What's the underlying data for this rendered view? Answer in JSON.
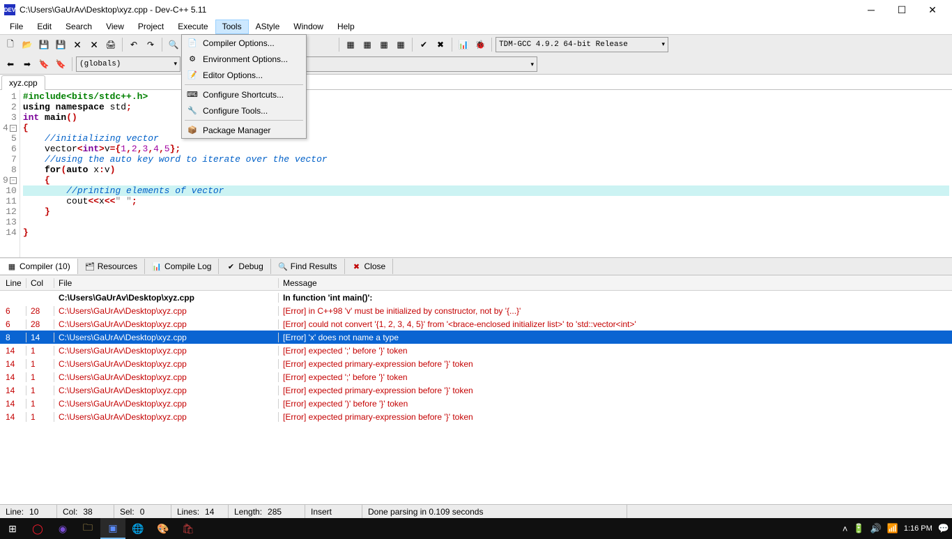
{
  "title": "C:\\Users\\GaUrAv\\Desktop\\xyz.cpp - Dev-C++ 5.11",
  "app_icon_text": "DEV",
  "menubar": [
    "File",
    "Edit",
    "Search",
    "View",
    "Project",
    "Execute",
    "Tools",
    "AStyle",
    "Window",
    "Help"
  ],
  "menubar_open_index": 6,
  "dropdown": {
    "groups": [
      [
        "Compiler Options...",
        "Environment Options...",
        "Editor Options..."
      ],
      [
        "Configure Shortcuts...",
        "Configure Tools..."
      ],
      [
        "Package Manager"
      ]
    ]
  },
  "toolbar": {
    "globals_label": "(globals)",
    "compiler_select": "TDM-GCC 4.9.2 64-bit Release"
  },
  "filetab": "xyz.cpp",
  "code_lines": 14,
  "bottom_tabs": {
    "compiler": "Compiler (10)",
    "resources": "Resources",
    "compile_log": "Compile Log",
    "debug": "Debug",
    "find_results": "Find Results",
    "close": "Close"
  },
  "compiler_table": {
    "headers": {
      "line": "Line",
      "col": "Col",
      "file": "File",
      "msg": "Message"
    },
    "context": {
      "file": "C:\\Users\\GaUrAv\\Desktop\\xyz.cpp",
      "msg": "In function 'int main()':"
    },
    "rows": [
      {
        "line": "6",
        "col": "28",
        "file": "C:\\Users\\GaUrAv\\Desktop\\xyz.cpp",
        "msg": "[Error] in C++98 'v' must be initialized by constructor, not by '{...}'"
      },
      {
        "line": "6",
        "col": "28",
        "file": "C:\\Users\\GaUrAv\\Desktop\\xyz.cpp",
        "msg": "[Error] could not convert '{1, 2, 3, 4, 5}' from '<brace-enclosed initializer list>' to 'std::vector<int>'"
      },
      {
        "line": "8",
        "col": "14",
        "file": "C:\\Users\\GaUrAv\\Desktop\\xyz.cpp",
        "msg": "[Error] 'x' does not name a type",
        "selected": true
      },
      {
        "line": "14",
        "col": "1",
        "file": "C:\\Users\\GaUrAv\\Desktop\\xyz.cpp",
        "msg": "[Error] expected ';' before '}' token"
      },
      {
        "line": "14",
        "col": "1",
        "file": "C:\\Users\\GaUrAv\\Desktop\\xyz.cpp",
        "msg": "[Error] expected primary-expression before '}' token"
      },
      {
        "line": "14",
        "col": "1",
        "file": "C:\\Users\\GaUrAv\\Desktop\\xyz.cpp",
        "msg": "[Error] expected ';' before '}' token"
      },
      {
        "line": "14",
        "col": "1",
        "file": "C:\\Users\\GaUrAv\\Desktop\\xyz.cpp",
        "msg": "[Error] expected primary-expression before '}' token"
      },
      {
        "line": "14",
        "col": "1",
        "file": "C:\\Users\\GaUrAv\\Desktop\\xyz.cpp",
        "msg": "[Error] expected ')' before '}' token"
      },
      {
        "line": "14",
        "col": "1",
        "file": "C:\\Users\\GaUrAv\\Desktop\\xyz.cpp",
        "msg": "[Error] expected primary-expression before '}' token"
      }
    ]
  },
  "status": {
    "line_lbl": "Line:",
    "line": "10",
    "col_lbl": "Col:",
    "col": "38",
    "sel_lbl": "Sel:",
    "sel": "0",
    "lines_lbl": "Lines:",
    "lines": "14",
    "len_lbl": "Length:",
    "len": "285",
    "mode": "Insert",
    "parse": "Done parsing in 0.109 seconds"
  },
  "taskbar": {
    "time": "1:16 PM"
  }
}
